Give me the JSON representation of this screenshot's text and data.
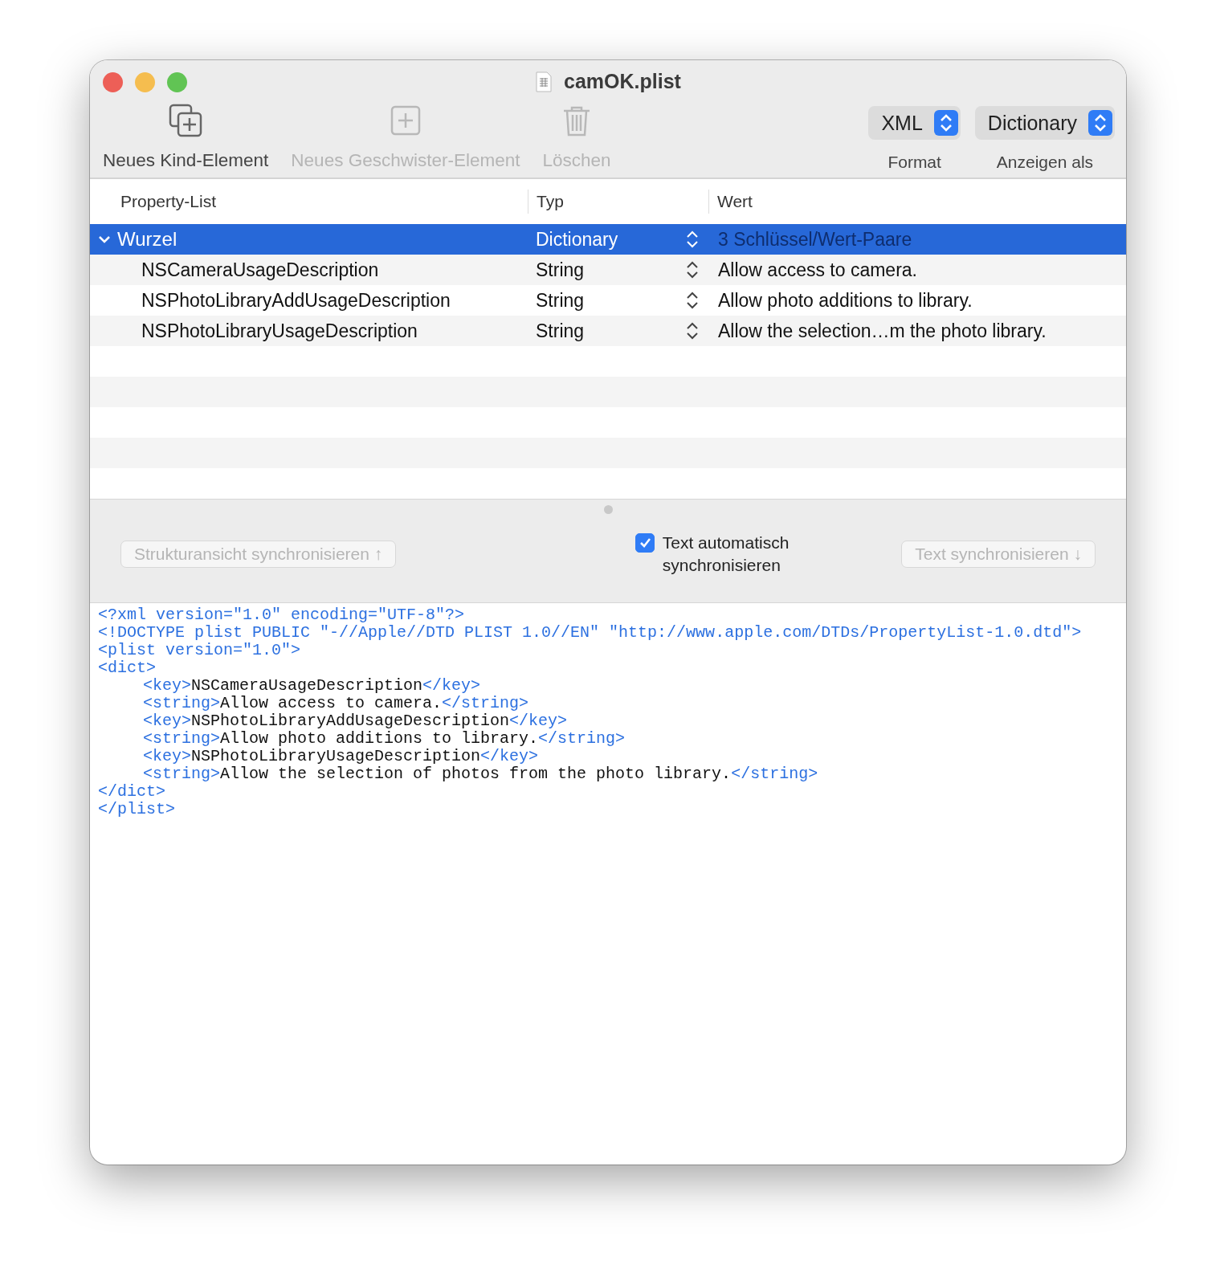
{
  "window": {
    "title": "camOK.plist"
  },
  "toolbar": {
    "items": [
      {
        "kind": "child",
        "label": "Neues Kind-Element",
        "disabled": false
      },
      {
        "kind": "sibling",
        "label": "Neues Geschwister-Element",
        "disabled": true
      },
      {
        "kind": "delete",
        "label": "Löschen",
        "disabled": true
      }
    ],
    "popups": [
      {
        "value": "XML",
        "label": "Format"
      },
      {
        "value": "Dictionary",
        "label": "Anzeigen als"
      }
    ]
  },
  "table": {
    "columns": [
      "Property-List",
      "Typ",
      "Wert"
    ],
    "rows": [
      {
        "name": "Wurzel",
        "type": "Dictionary",
        "value": "3 Schlüssel/Wert-Paare",
        "selected": true,
        "expanded": true,
        "children": [
          {
            "name": "NSCameraUsageDescription",
            "type": "String",
            "value": "Allow access to camera.",
            "selected": false
          },
          {
            "name": "NSPhotoLibraryAddUsageDescription",
            "type": "String",
            "value": "Allow photo additions to library.",
            "selected": false
          },
          {
            "name": "NSPhotoLibraryUsageDescription",
            "type": "String",
            "value": "Allow the selection…m the photo library.",
            "selected": false
          }
        ]
      }
    ]
  },
  "sync": {
    "left_button": {
      "label": "Strukturansicht synchronisieren ↑",
      "disabled": true
    },
    "checkbox": {
      "label": "Text automatisch synchronisieren",
      "checked": true
    },
    "right_button": {
      "label": "Text synchronisieren ↓",
      "disabled": true
    }
  },
  "editor": {
    "lines": [
      {
        "indented": false,
        "parts": [
          {
            "kind": "markup",
            "text": "<?xml version=\"1.0\" encoding=\"UTF-8\"?>"
          }
        ]
      },
      {
        "indented": false,
        "parts": [
          {
            "kind": "markup",
            "text": "<!DOCTYPE plist PUBLIC \"-//Apple//DTD PLIST 1.0//EN\" \"http://www.apple.com/DTDs/PropertyList-1.0.dtd\">"
          }
        ]
      },
      {
        "indented": false,
        "parts": [
          {
            "kind": "markup",
            "text": "<plist version=\"1.0\">"
          }
        ]
      },
      {
        "indented": false,
        "parts": [
          {
            "kind": "markup",
            "text": "<dict>"
          }
        ]
      },
      {
        "indented": true,
        "parts": [
          {
            "kind": "markup",
            "text": "<key>"
          },
          {
            "kind": "text",
            "text": "NSCameraUsageDescription"
          },
          {
            "kind": "markup",
            "text": "</key>"
          }
        ]
      },
      {
        "indented": true,
        "parts": [
          {
            "kind": "markup",
            "text": "<string>"
          },
          {
            "kind": "text",
            "text": "Allow access to camera."
          },
          {
            "kind": "markup",
            "text": "</string>"
          }
        ]
      },
      {
        "indented": true,
        "parts": [
          {
            "kind": "markup",
            "text": "<key>"
          },
          {
            "kind": "text",
            "text": "NSPhotoLibraryAddUsageDescription"
          },
          {
            "kind": "markup",
            "text": "</key>"
          }
        ]
      },
      {
        "indented": true,
        "parts": [
          {
            "kind": "markup",
            "text": "<string>"
          },
          {
            "kind": "text",
            "text": "Allow photo additions to library."
          },
          {
            "kind": "markup",
            "text": "</string>"
          }
        ]
      },
      {
        "indented": true,
        "parts": [
          {
            "kind": "markup",
            "text": "<key>"
          },
          {
            "kind": "text",
            "text": "NSPhotoLibraryUsageDescription"
          },
          {
            "kind": "markup",
            "text": "</key>"
          }
        ]
      },
      {
        "indented": true,
        "parts": [
          {
            "kind": "markup",
            "text": "<string>"
          },
          {
            "kind": "text",
            "text": "Allow the selection of photos from the photo library."
          },
          {
            "kind": "markup",
            "text": "</string>"
          }
        ]
      },
      {
        "indented": false,
        "parts": [
          {
            "kind": "markup",
            "text": "</dict>"
          }
        ]
      },
      {
        "indented": false,
        "parts": [
          {
            "kind": "markup",
            "text": "</plist>"
          }
        ]
      }
    ]
  }
}
